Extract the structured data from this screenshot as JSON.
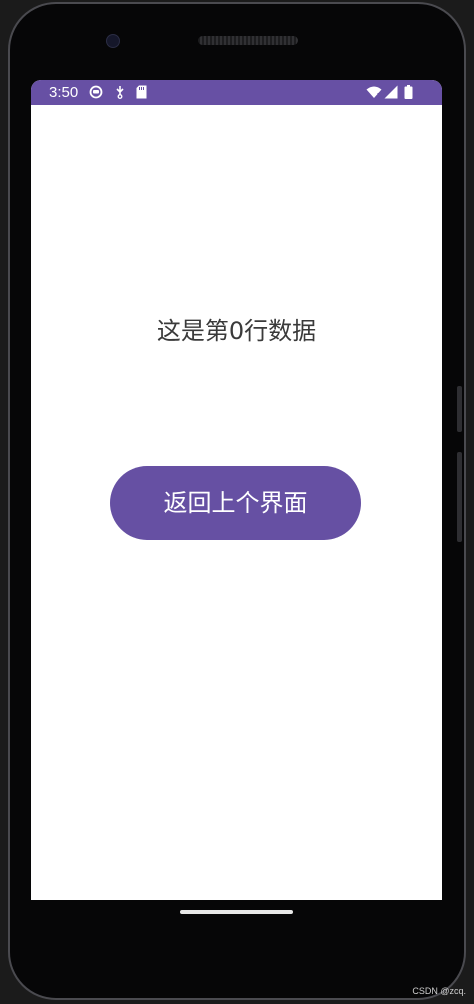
{
  "status_bar": {
    "time": "3:50",
    "background_color": "#6750a4",
    "left_icons": [
      "assistant-icon",
      "usb-debug-icon",
      "sd-card-icon"
    ],
    "right_icons": [
      "wifi-icon",
      "cellular-signal-icon",
      "battery-icon"
    ]
  },
  "screen": {
    "message": "这是第0行数据",
    "back_button_label": "返回上个界面",
    "button_color": "#6650a3"
  },
  "watermark": "CSDN @zcq."
}
